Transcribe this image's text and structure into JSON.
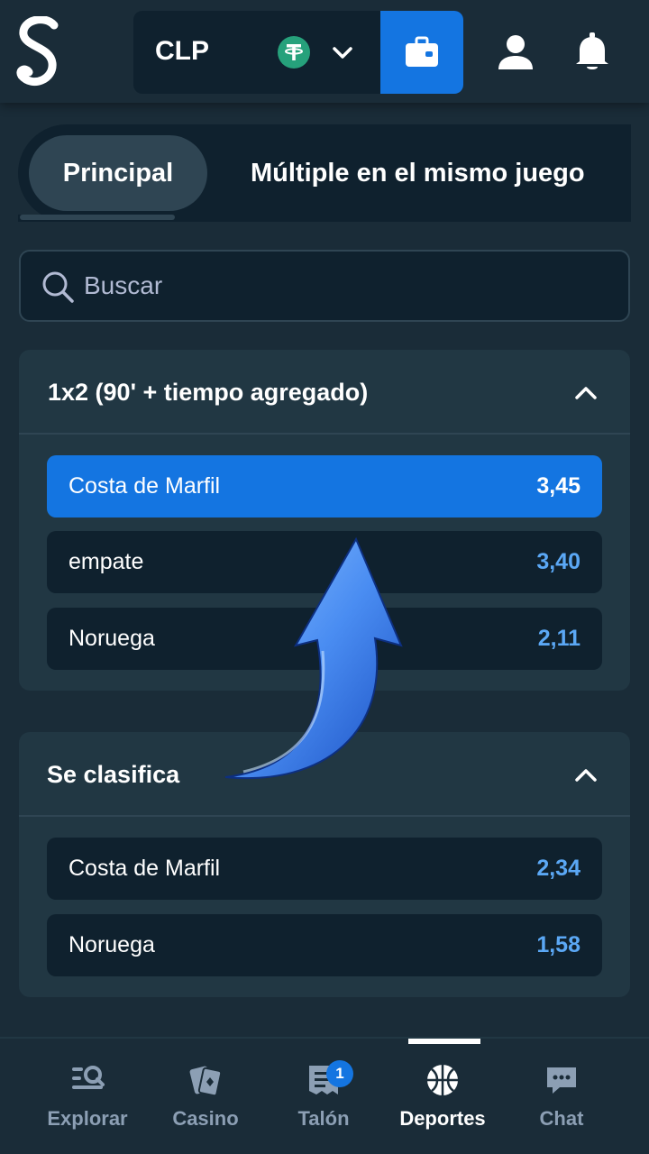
{
  "header": {
    "currency": "CLP",
    "currency_icon": "tether-icon",
    "wallet_icon": "wallet-icon",
    "user_icon": "user-icon",
    "notifications_icon": "bell-icon"
  },
  "tabs": [
    {
      "label": "Principal",
      "active": true
    },
    {
      "label": "Múltiple en el mismo juego",
      "active": false
    }
  ],
  "search": {
    "placeholder": "Buscar",
    "value": ""
  },
  "markets": [
    {
      "title": "1x2 (90' + tiempo agregado)",
      "outcomes": [
        {
          "name": "Costa de Marfil",
          "odds": "3,45",
          "selected": true
        },
        {
          "name": "empate",
          "odds": "3,40",
          "selected": false
        },
        {
          "name": "Noruega",
          "odds": "2,11",
          "selected": false
        }
      ]
    },
    {
      "title": "Se clasifica",
      "outcomes": [
        {
          "name": "Costa de Marfil",
          "odds": "2,34",
          "selected": false
        },
        {
          "name": "Noruega",
          "odds": "1,58",
          "selected": false
        }
      ]
    }
  ],
  "bottom_nav": [
    {
      "label": "Explorar",
      "icon": "explore-icon",
      "active": false
    },
    {
      "label": "Casino",
      "icon": "cards-icon",
      "active": false
    },
    {
      "label": "Talón",
      "icon": "betslip-icon",
      "active": false,
      "badge": "1"
    },
    {
      "label": "Deportes",
      "icon": "basketball-icon",
      "active": true
    },
    {
      "label": "Chat",
      "icon": "chat-icon",
      "active": false
    }
  ],
  "colors": {
    "background": "#1a2c38",
    "card": "#213743",
    "input": "#0f212e",
    "accent": "#1475e1",
    "odds": "#5ba8f5"
  }
}
